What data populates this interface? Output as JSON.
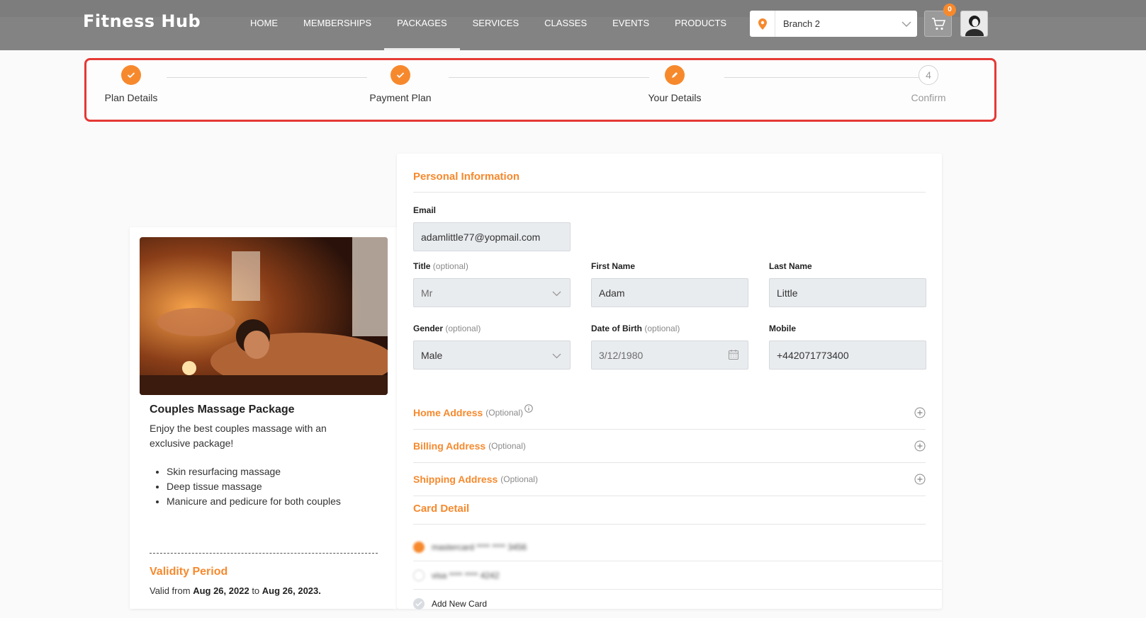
{
  "header": {
    "brand": "Fitness Hub",
    "nav": [
      "HOME",
      "MEMBERSHIPS",
      "PACKAGES",
      "SERVICES",
      "CLASSES",
      "EVENTS",
      "PRODUCTS"
    ],
    "active_nav": "PACKAGES",
    "branch": "Branch 2",
    "cart_count": "0"
  },
  "steps": [
    {
      "label": "Plan Details",
      "status": "done"
    },
    {
      "label": "Payment Plan",
      "status": "done"
    },
    {
      "label": "Your Details",
      "status": "current"
    },
    {
      "label": "Confirm",
      "number": "4",
      "status": "pending"
    }
  ],
  "package": {
    "title": "Couples Massage Package",
    "description": "Enjoy the best couples massage with an exclusive package!",
    "features": [
      "Skin resurfacing massage",
      "Deep tissue massage",
      "Manicure and pedicure for both couples"
    ],
    "validity_title": "Validity Period",
    "validity_prefix": "Valid from",
    "valid_from": "Aug 26, 2022",
    "validity_to": "to",
    "valid_to": "Aug 26, 2023."
  },
  "personal": {
    "section_title": "Personal Information",
    "email_label": "Email",
    "email": "adamlittle77@yopmail.com",
    "title_label": "Title",
    "title_opt": "(optional)",
    "title_value": "Mr",
    "first_name_label": "First Name",
    "first_name": "Adam",
    "last_name_label": "Last Name",
    "last_name": "Little",
    "gender_label": "Gender",
    "gender_opt": "(optional)",
    "gender": "Male",
    "dob_label": "Date of Birth",
    "dob_opt": "(optional)",
    "dob": "3/12/1980",
    "mobile_label": "Mobile",
    "mobile": "+442071773400"
  },
  "addresses": [
    {
      "title": "Home Address",
      "opt": "(Optional)"
    },
    {
      "title": "Billing Address",
      "opt": "(Optional)"
    },
    {
      "title": "Shipping Address",
      "opt": "(Optional)"
    }
  ],
  "card": {
    "section_title": "Card Detail",
    "cards": [
      "mastercard **** **** 3456",
      "visa **** **** 4242"
    ],
    "add_new": "Add New Card"
  },
  "colors": {
    "accent": "#f7892d",
    "highlight_border": "#e53935",
    "header_bg": "#838383"
  }
}
